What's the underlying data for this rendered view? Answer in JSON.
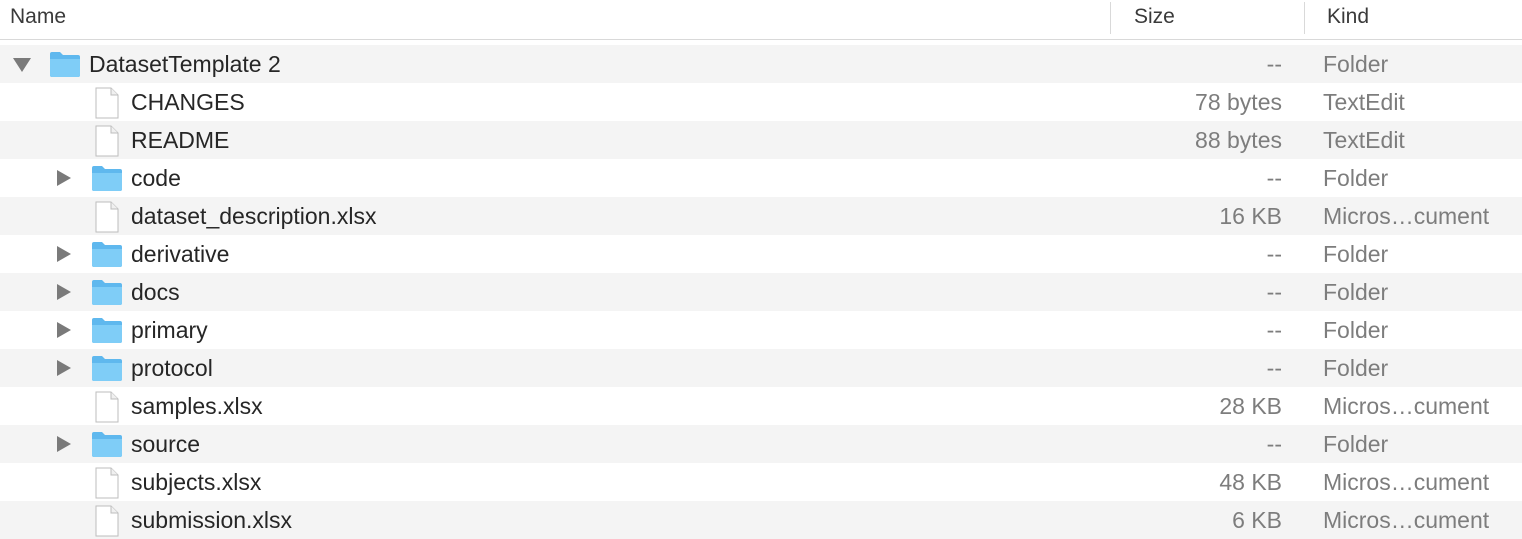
{
  "columns": {
    "name": "Name",
    "size": "Size",
    "kind": "Kind"
  },
  "rows": [
    {
      "name": "DatasetTemplate 2",
      "size": "--",
      "kind": "Folder",
      "type": "folder",
      "level": 0,
      "disclosure": "expanded"
    },
    {
      "name": "CHANGES",
      "size": "78 bytes",
      "kind": "TextEdit",
      "type": "file",
      "level": 1,
      "disclosure": "none"
    },
    {
      "name": "README",
      "size": "88 bytes",
      "kind": "TextEdit",
      "type": "file",
      "level": 1,
      "disclosure": "none"
    },
    {
      "name": "code",
      "size": "--",
      "kind": "Folder",
      "type": "folder",
      "level": 1,
      "disclosure": "collapsed"
    },
    {
      "name": "dataset_description.xlsx",
      "size": "16 KB",
      "kind": "Micros…cument",
      "type": "file",
      "level": 1,
      "disclosure": "none"
    },
    {
      "name": "derivative",
      "size": "--",
      "kind": "Folder",
      "type": "folder",
      "level": 1,
      "disclosure": "collapsed"
    },
    {
      "name": "docs",
      "size": "--",
      "kind": "Folder",
      "type": "folder",
      "level": 1,
      "disclosure": "collapsed"
    },
    {
      "name": "primary",
      "size": "--",
      "kind": "Folder",
      "type": "folder",
      "level": 1,
      "disclosure": "collapsed"
    },
    {
      "name": "protocol",
      "size": "--",
      "kind": "Folder",
      "type": "folder",
      "level": 1,
      "disclosure": "collapsed"
    },
    {
      "name": "samples.xlsx",
      "size": "28 KB",
      "kind": "Micros…cument",
      "type": "file",
      "level": 1,
      "disclosure": "none"
    },
    {
      "name": "source",
      "size": "--",
      "kind": "Folder",
      "type": "folder",
      "level": 1,
      "disclosure": "collapsed"
    },
    {
      "name": "subjects.xlsx",
      "size": "48 KB",
      "kind": "Micros…cument",
      "type": "file",
      "level": 1,
      "disclosure": "none"
    },
    {
      "name": "submission.xlsx",
      "size": "6 KB",
      "kind": "Micros…cument",
      "type": "file",
      "level": 1,
      "disclosure": "none"
    }
  ]
}
